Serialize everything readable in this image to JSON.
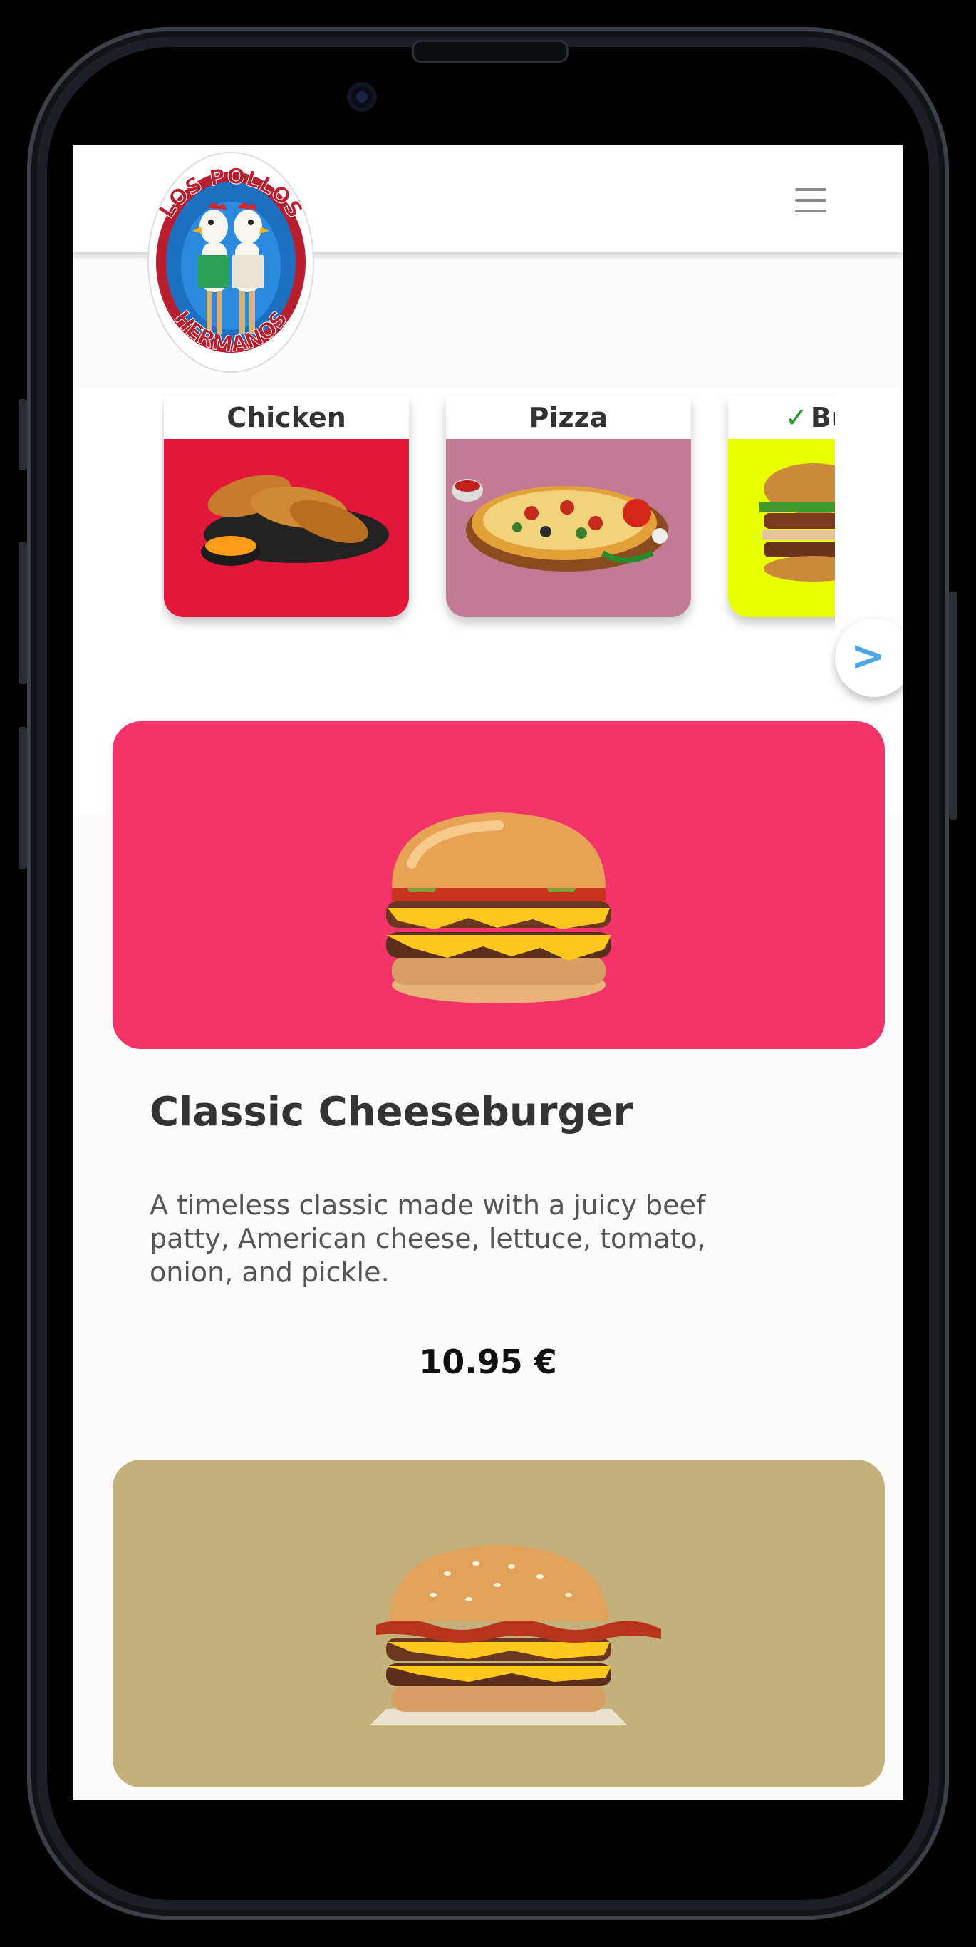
{
  "header": {
    "logo_alt": "LOS POLLOS HERMANOS",
    "logo_top_text": "LOS POLLOS",
    "logo_bottom_text": "HERMANOS",
    "menu_icon": "hamburger-menu-icon"
  },
  "categories": [
    {
      "label": "Chicken",
      "selected": false,
      "bg": "#e3173c"
    },
    {
      "label": "Pizza",
      "selected": false,
      "bg": "#c27b95"
    },
    {
      "label": "Bu",
      "selected": true,
      "check": "✓",
      "bg": "#e8ff00"
    }
  ],
  "carousel": {
    "next_label": ">"
  },
  "items": [
    {
      "title": "Classic Cheeseburger",
      "description": "A timeless classic made with a juicy beef patty, American cheese, lettuce, tomato, onion, and pickle.",
      "price": "10.95 €",
      "bg": "#f2346a"
    },
    {
      "bg": "#c4b07a"
    }
  ]
}
